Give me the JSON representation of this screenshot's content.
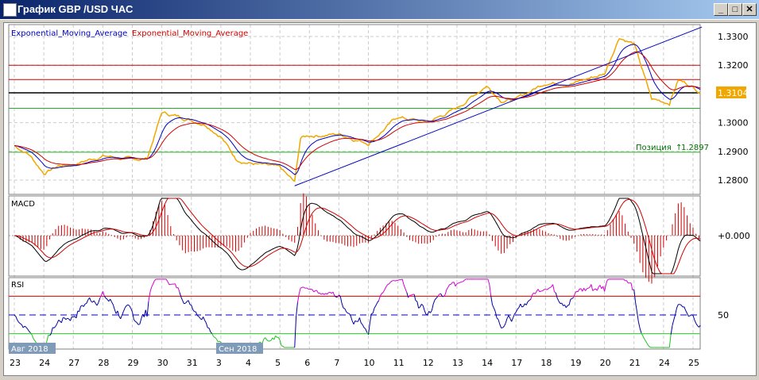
{
  "window": {
    "title": "График GBP /USD  ЧАС",
    "minimize": "_",
    "maximize": "□",
    "close": "✕"
  },
  "legend": {
    "ema_fast": "Exponential_Moving_Average",
    "ema_slow": "Exponential_Moving_Average"
  },
  "price_axis": [
    "1.3300",
    "1.3200",
    "1.3000",
    "1.2900",
    "1.2800"
  ],
  "current_price": "1.3104",
  "position": {
    "label": "Позиция",
    "value": "1.2897"
  },
  "levels": {
    "red": [
      1.32,
      1.315
    ],
    "black": 1.3104,
    "green": [
      1.305,
      1.2897
    ]
  },
  "macd": {
    "label": "MACD",
    "zero": "+0.000"
  },
  "rsi": {
    "label": "RSI",
    "mid": "50"
  },
  "months": [
    "Авг 2018",
    "Сен 2018"
  ],
  "days": [
    "23",
    "24",
    "27",
    "28",
    "29",
    "30",
    "31",
    "3",
    "4",
    "5",
    "6",
    "7",
    "10",
    "11",
    "12",
    "13",
    "14",
    "17",
    "18",
    "19",
    "20",
    "21",
    "24",
    "25"
  ],
  "colors": {
    "price": "#f0a800",
    "ema_fast": "#0000c0",
    "ema_slow": "#d00000",
    "macd": "#000000"
  },
  "chart_data": {
    "type": "line",
    "price_key_points": [
      [
        0,
        1.292
      ],
      [
        0.5,
        1.289
      ],
      [
        1,
        1.2825
      ],
      [
        1.5,
        1.285
      ],
      [
        2,
        1.2855
      ],
      [
        3,
        1.2885
      ],
      [
        4,
        1.287
      ],
      [
        4.5,
        1.2875
      ],
      [
        5,
        1.3035
      ],
      [
        6,
        1.301
      ],
      [
        6.5,
        1.2995
      ],
      [
        7,
        1.2955
      ],
      [
        7.5,
        1.2875
      ],
      [
        8,
        1.286
      ],
      [
        9,
        1.284
      ],
      [
        9.5,
        1.279
      ],
      [
        9.7,
        1.2945
      ],
      [
        10,
        1.2955
      ],
      [
        11,
        1.296
      ],
      [
        12,
        1.293
      ],
      [
        13,
        1.302
      ],
      [
        14,
        1.3
      ],
      [
        15,
        1.305
      ],
      [
        16,
        1.313
      ],
      [
        16.5,
        1.308
      ],
      [
        17,
        1.308
      ],
      [
        18,
        1.314
      ],
      [
        19,
        1.314
      ],
      [
        20,
        1.317
      ],
      [
        20.5,
        1.33
      ],
      [
        21,
        1.3275
      ],
      [
        21.6,
        1.308
      ],
      [
        22.2,
        1.307
      ],
      [
        22.5,
        1.315
      ],
      [
        23,
        1.3125
      ],
      [
        23.3,
        1.3104
      ]
    ],
    "trendline": [
      [
        9.5,
        1.278
      ],
      [
        23.3,
        1.3333
      ]
    ]
  }
}
